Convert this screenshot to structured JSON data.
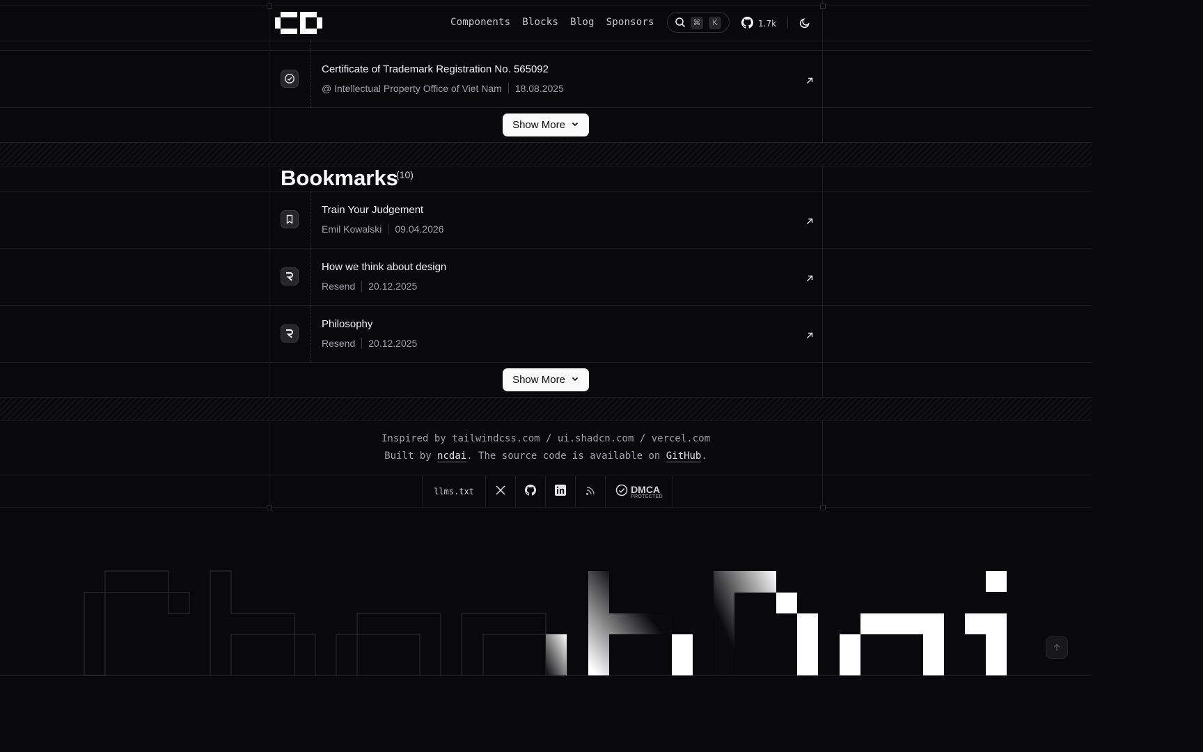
{
  "nav": {
    "items": [
      "Components",
      "Blocks",
      "Blog",
      "Sponsors"
    ],
    "search_kbd_1": "⌘",
    "search_kbd_2": "K",
    "github_stars": "1.7k"
  },
  "certifications": {
    "last_item": {
      "title": "Certificate of Trademark Registration No. 565092",
      "issuer": "@ Intellectual Property Office of Viet Nam",
      "date": "18.08.2025",
      "icon": "check-circle-icon"
    },
    "show_more": "Show More"
  },
  "bookmarks": {
    "title": "Bookmarks",
    "count": "(10)",
    "items": [
      {
        "title": "Train Your Judgement",
        "author": "Emil Kowalski",
        "date": "09.04.2026",
        "icon": "bookmark-icon"
      },
      {
        "title": "How we think about design",
        "author": "Resend",
        "date": "20.12.2025",
        "icon": "resend-logo-icon"
      },
      {
        "title": "Philosophy",
        "author": "Resend",
        "date": "20.12.2025",
        "icon": "resend-logo-icon"
      }
    ],
    "show_more": "Show More"
  },
  "footer": {
    "inspired_prefix": "Inspired by tailwindcss.com / ui.shadcn.com / vercel.com",
    "built_by_prefix": "Built by ",
    "built_by_link": "ncdai",
    "built_by_mid": ". The source code is available on ",
    "source_link": "GitHub",
    "built_by_suffix": ".",
    "llms": "llms.txt",
    "dmca_top": "DMCA",
    "dmca_bottom": "PROTECTED"
  },
  "colors": {
    "background": "#09090b",
    "foreground": "#fafafa",
    "muted": "#a1a1aa",
    "border": "#1f1f23"
  }
}
